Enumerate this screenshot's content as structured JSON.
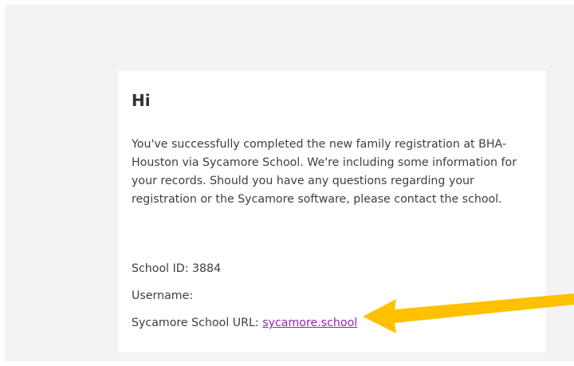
{
  "email": {
    "greeting": "Hi",
    "body": "You've successfully completed the new family registration at BHA-Houston via Sycamore School. We're including some information for your records. Should you have any questions regarding your registration or the Sycamore software, please contact the school.",
    "school_id_line": "School ID: 3884",
    "username_line": "Username:",
    "url_label": "Sycamore School URL: ",
    "url_link_text": "sycamore.school"
  },
  "colors": {
    "page_background": "#f3f3f3",
    "card_background": "#ffffff",
    "text": "#3b3f45",
    "link": "#8a2aa3",
    "arrow_annotation": "#ffc000"
  },
  "icons": {
    "annotation": "arrow-left-icon"
  }
}
